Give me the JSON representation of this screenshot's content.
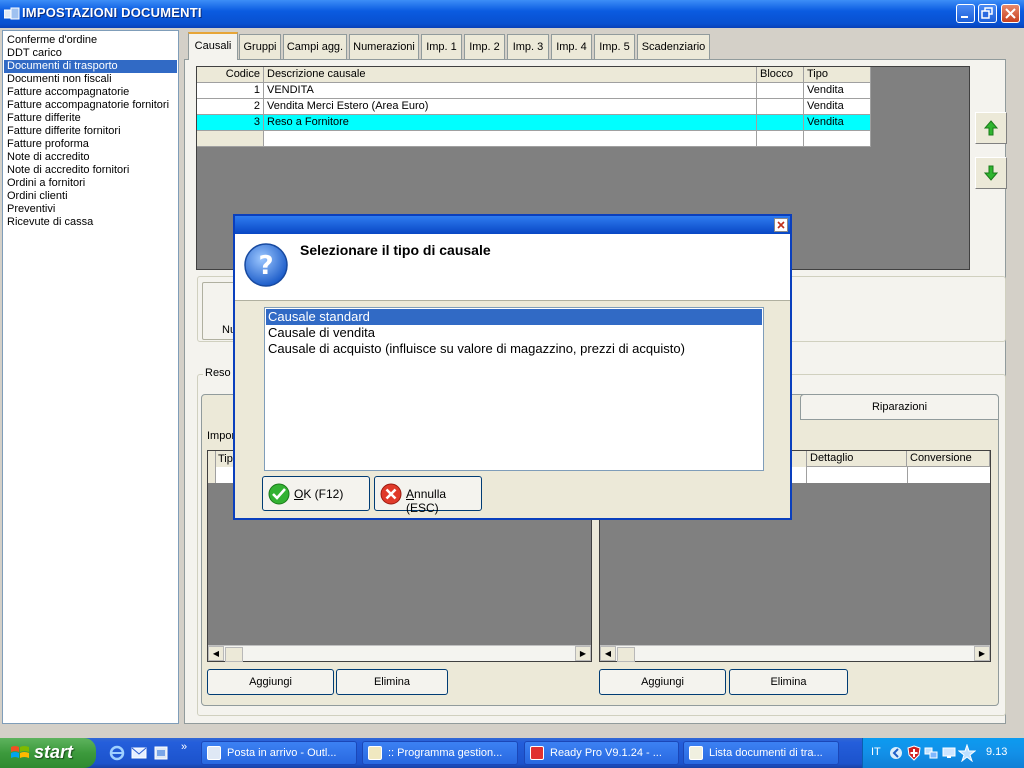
{
  "window": {
    "title": "IMPOSTAZIONI DOCUMENTI"
  },
  "doc_list": [
    "Conferme d'ordine",
    "DDT carico",
    "Documenti di trasporto",
    "Documenti non fiscali",
    "Fatture accompagnatorie",
    "Fatture accompagnatorie fornitori",
    "Fatture differite",
    "Fatture differite fornitori",
    "Fatture proforma",
    "Note di accredito",
    "Note di accredito fornitori",
    "Ordini a fornitori",
    "Ordini clienti",
    "Preventivi",
    "Ricevute di cassa"
  ],
  "doc_list_selected": "Documenti di trasporto",
  "tabs": [
    "Causali",
    "Gruppi",
    "Campi agg.",
    "Numerazioni",
    "Imp. 1",
    "Imp. 2",
    "Imp. 3",
    "Imp. 4",
    "Imp. 5",
    "Scadenziario"
  ],
  "active_tab": "Causali",
  "grid": {
    "headers": [
      "Codice",
      "Descrizione causale",
      "Blocco",
      "Tipo"
    ],
    "rows": [
      {
        "codice": "1",
        "descrizione": "VENDITA",
        "blocco": "",
        "tipo": "Vendita"
      },
      {
        "codice": "2",
        "descrizione": "Vendita Merci Estero (Area Euro)",
        "blocco": "",
        "tipo": "Vendita"
      },
      {
        "codice": "3",
        "descrizione": "Reso a Fornitore",
        "blocco": "",
        "tipo": "Vendita"
      }
    ]
  },
  "lower": {
    "partial_left_label": "Nu",
    "reso_group": "Reso",
    "riparazioni_tab": "Riparazioni",
    "import_label": "Impor",
    "left_header_partial": "Tip",
    "right_headers": [
      "Dettaglio",
      "Conversione"
    ],
    "left_buttons": [
      "Aggiungi",
      "Elimina"
    ],
    "right_buttons": [
      "Aggiungi",
      "Elimina"
    ]
  },
  "dialog": {
    "question": "Selezionare il tipo di causale",
    "options": [
      "Causale standard",
      "Causale di vendita",
      "Causale di acquisto (influisce su valore di magazzino, prezzi di acquisto)"
    ],
    "selected": "Causale standard",
    "ok_accel": "O",
    "ok_rest": "K (F12)",
    "cancel_accel": "A",
    "cancel_rest": "nnulla (ESC)"
  },
  "taskbar": {
    "start": "start",
    "items": [
      "Posta in arrivo - Outl...",
      ":: Programma gestion...",
      "Ready Pro V9.1.24 - ...",
      "Lista documenti di tra..."
    ],
    "language": "IT",
    "clock": "9.13"
  },
  "colors": {
    "selection": "#316ac5",
    "highlight_row": "#00ffff",
    "titlebar": "#0a5be0",
    "taskbar": "#245edb"
  }
}
